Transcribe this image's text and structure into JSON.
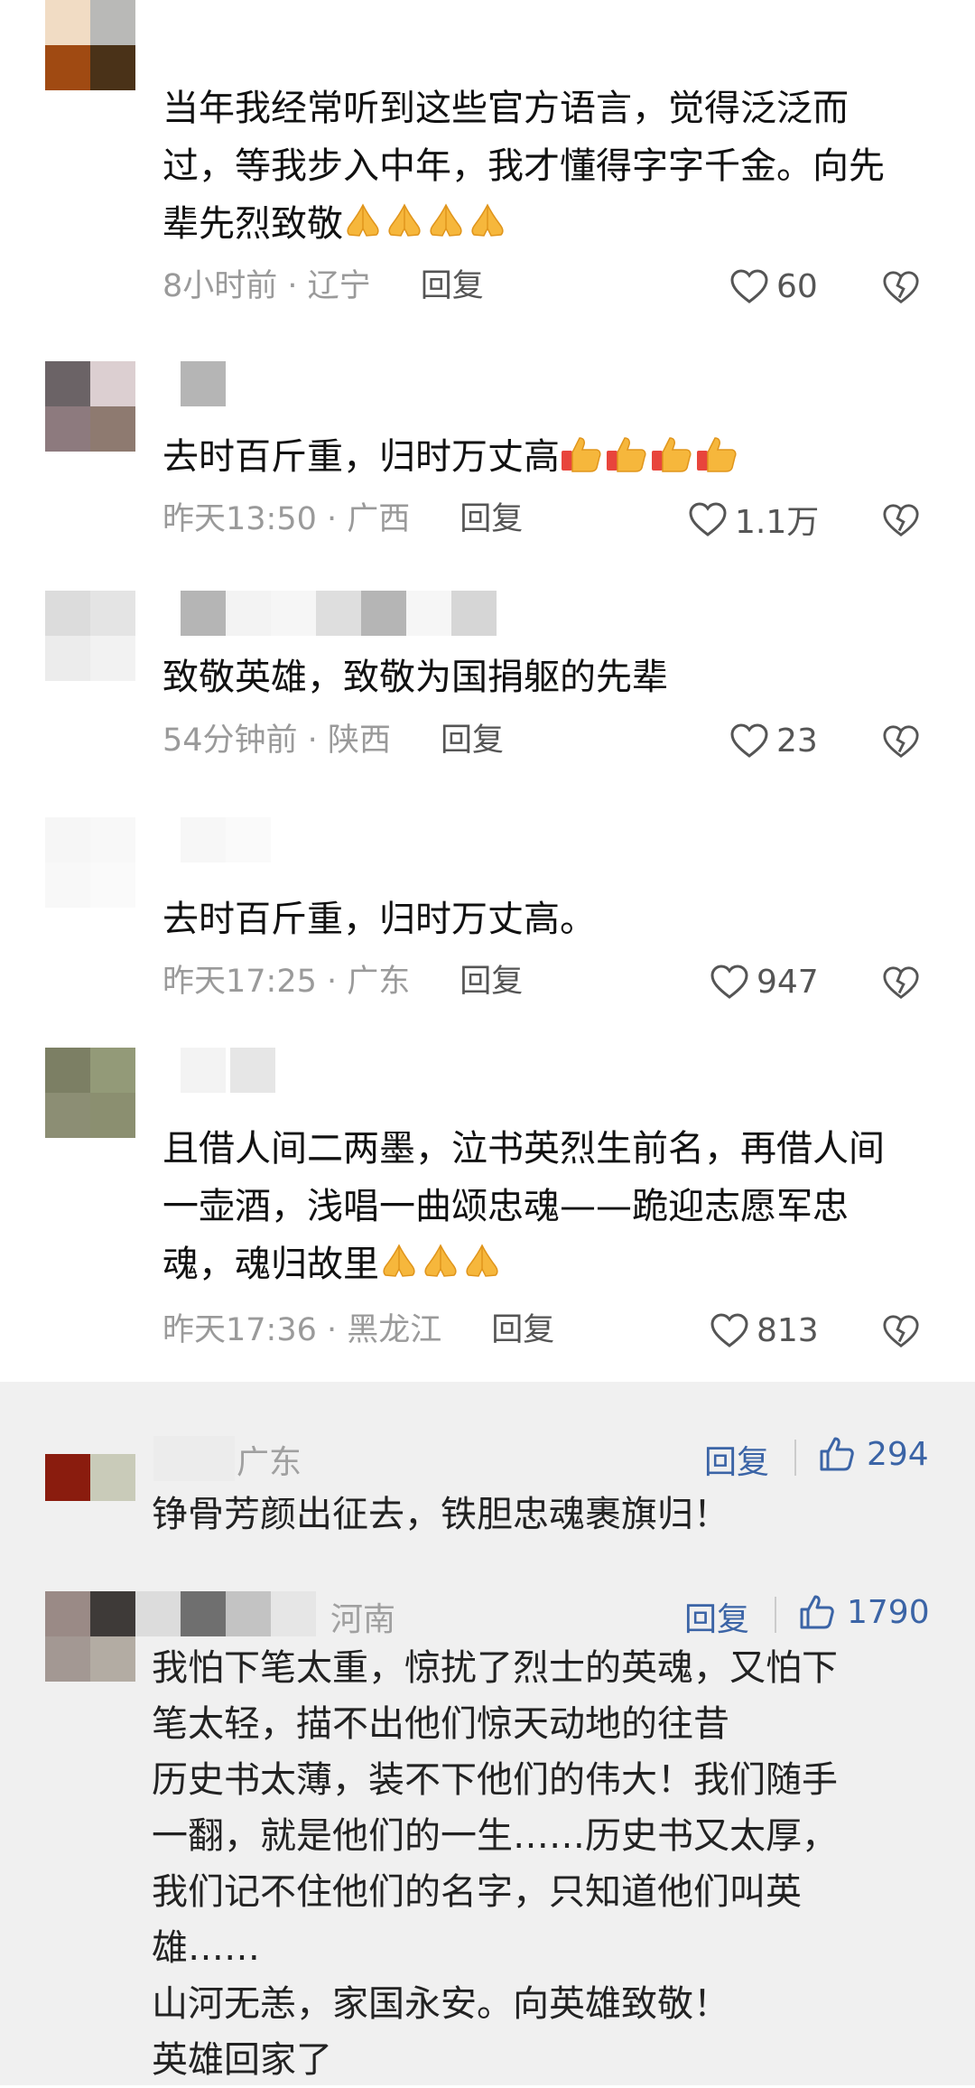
{
  "comments": [
    {
      "text": "当年我经常听到这些官方语言，觉得泛泛而过，等我步入中年，我才懂得字字千金。向先辈先烈致敬",
      "emoji": "pray",
      "emoji_count": 4,
      "time": "8小时前",
      "location": "辽宁",
      "reply": "回复",
      "likes": "60"
    },
    {
      "text": "去时百斤重，归时万丈高",
      "emoji": "thumbs-up",
      "emoji_count": 4,
      "time": "昨天13:50",
      "location": "广西",
      "reply": "回复",
      "likes": "1.1万"
    },
    {
      "text": "致敬英雄，致敬为国捐躯的先辈",
      "emoji": "",
      "emoji_count": 0,
      "time": "54分钟前",
      "location": "陕西",
      "reply": "回复",
      "likes": "23"
    },
    {
      "text": "去时百斤重，归时万丈高。",
      "emoji": "",
      "emoji_count": 0,
      "time": "昨天17:25",
      "location": "广东",
      "reply": "回复",
      "likes": "947"
    },
    {
      "text": "且借人间二两墨，泣书英烈生前名，再借人间一壶酒，浅唱一曲颂忠魂——跪迎志愿军忠魂，魂归故里",
      "emoji": "pray",
      "emoji_count": 3,
      "time": "昨天17:36",
      "location": "黑龙江",
      "reply": "回复",
      "likes": "813"
    }
  ],
  "quoted": [
    {
      "location": "广东",
      "reply": "回复",
      "likes": "294",
      "lines": [
        "铮骨芳颜出征去，铁胆忠魂裹旗归！"
      ]
    },
    {
      "location": "河南",
      "reply": "回复",
      "likes": "1790",
      "lines": [
        "我怕下笔太重，惊扰了烈士的英魂，又怕下",
        "笔太轻，描不出他们惊天动地的往昔",
        "历史书太薄，装不下他们的伟大！我们随手",
        "一翻，就是他们的一生……历史书又太厚，",
        "我们记不住他们的名字，只知道他们叫英",
        "雄……",
        "山河无恙，家国永安。向英雄致敬！",
        "英雄回家了"
      ]
    }
  ],
  "icons": {
    "like": "heart-outline-icon",
    "dislike": "broken-heart-icon",
    "quoted_like": "thumbs-up-outline-icon"
  },
  "colors": {
    "link_blue": "#3b64a6",
    "meta_grey": "#9a9a9a",
    "grey_bg": "#f0f0f0"
  }
}
